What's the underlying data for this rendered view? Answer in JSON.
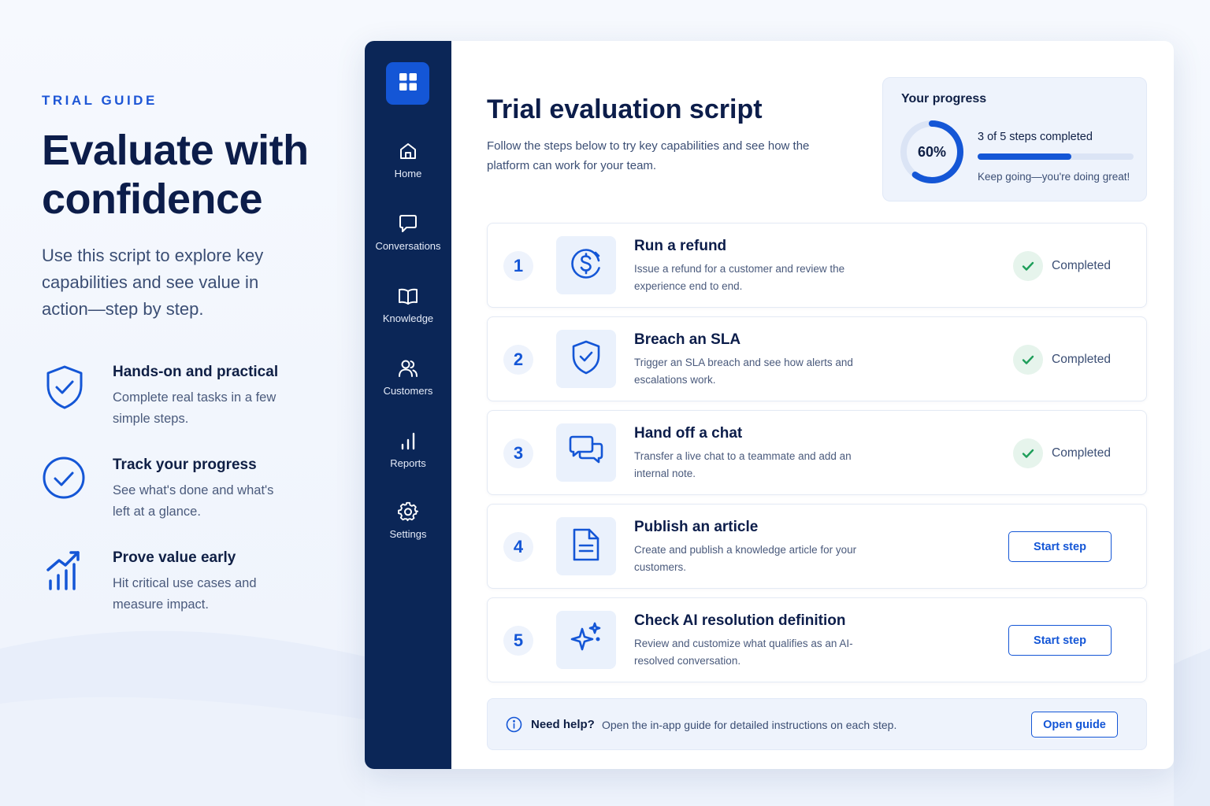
{
  "hero": {
    "eyebrow": "TRIAL GUIDE",
    "title": "Evaluate with confidence",
    "subtitle": "Use this script to explore key capabilities and see value in action—step by step.",
    "benefits": [
      {
        "icon": "shield-check-icon",
        "title": "Hands-on and practical",
        "description": "Complete real tasks in a few simple steps."
      },
      {
        "icon": "circle-check-icon",
        "title": "Track your progress",
        "description": "See what's done and what's left at a glance."
      },
      {
        "icon": "chart-growth-icon",
        "title": "Prove value early",
        "description": "Hit critical use cases and measure impact."
      }
    ]
  },
  "sidebar": {
    "logo_icon": "grid-icon",
    "items": [
      {
        "icon": "home-icon",
        "label": "Home"
      },
      {
        "icon": "chat-bubble-icon",
        "label": "Conversations"
      },
      {
        "icon": "book-icon",
        "label": "Knowledge"
      },
      {
        "icon": "users-icon",
        "label": "Customers"
      },
      {
        "icon": "bar-chart-icon",
        "label": "Reports"
      },
      {
        "icon": "gear-icon",
        "label": "Settings"
      }
    ]
  },
  "main": {
    "title": "Trial evaluation script",
    "subtitle": "Follow the steps below to try key capabilities and see how the platform can work for your team."
  },
  "progress": {
    "title": "Your progress",
    "percent_label": "60%",
    "fraction": 0.6,
    "steps_text": "3 of 5 steps completed",
    "message": "Keep going—you're doing great!"
  },
  "steps": [
    {
      "number": "1",
      "icon": "refund-dollar-icon",
      "title": "Run a refund",
      "description": "Issue a refund for a customer and review the experience end to end.",
      "status": "Completed"
    },
    {
      "number": "2",
      "icon": "shield-check-icon",
      "title": "Breach an SLA",
      "description": "Trigger an SLA breach and see how alerts and escalations work.",
      "status": "Completed"
    },
    {
      "number": "3",
      "icon": "chat-handoff-icon",
      "title": "Hand off a chat",
      "description": "Transfer a live chat to a teammate and add an internal note.",
      "status": "Completed"
    },
    {
      "number": "4",
      "icon": "document-icon",
      "title": "Publish an article",
      "description": "Create and publish a knowledge article for your customers.",
      "action": "Start step"
    },
    {
      "number": "5",
      "icon": "sparkle-icon",
      "title": "Check AI resolution definition",
      "description": "Review and customize what qualifies as an AI-resolved conversation.",
      "action": "Start step"
    }
  ],
  "help": {
    "icon": "info-icon",
    "title": "Need help?",
    "text": "Open the in-app guide for detailed instructions on each step.",
    "button": "Open guide"
  },
  "colors": {
    "accent": "#1456d6",
    "sidebar": "#0b2657",
    "success": "#1e9e5a",
    "heading": "#0c1d4a"
  }
}
